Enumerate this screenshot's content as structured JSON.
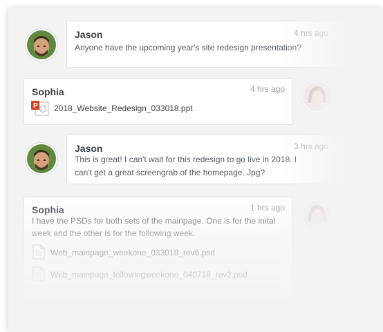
{
  "messages": [
    {
      "sender": "Jason",
      "time": "4 hrs ago",
      "text": "Anyone have the upcoming year's site redesign presentation?"
    },
    {
      "sender": "Sophia",
      "time": "4 hrs ago",
      "file": {
        "name": "2018_Website_Redesign_033018.ppt",
        "icon": "powerpoint-file-icon"
      }
    },
    {
      "sender": "Jason",
      "time": "3 hrs ago",
      "text_line1": "This is great! I can't wait for this redesign to go live in 2018. I",
      "text_line2": "can't get a great screengrab of the homepage. Jpg?"
    },
    {
      "sender": "Sophia",
      "time": "1 hrs ago",
      "text_line1": "I have the PSDs for both sets of the mainpage. One is for the inital",
      "text_line2": "week and the other is for the following week.",
      "files": [
        {
          "name": "Web_mainpage_weekone_033018_rev6.psd",
          "icon": "document-file-icon"
        },
        {
          "name": "Web_mainpage_followingweekone_040718_rev2.psd",
          "icon": "document-file-icon"
        }
      ]
    }
  ],
  "colors": {
    "panel_bg": "#f3f3f4",
    "bubble_bg": "#ffffff",
    "powerpoint_red": "#d04423"
  }
}
